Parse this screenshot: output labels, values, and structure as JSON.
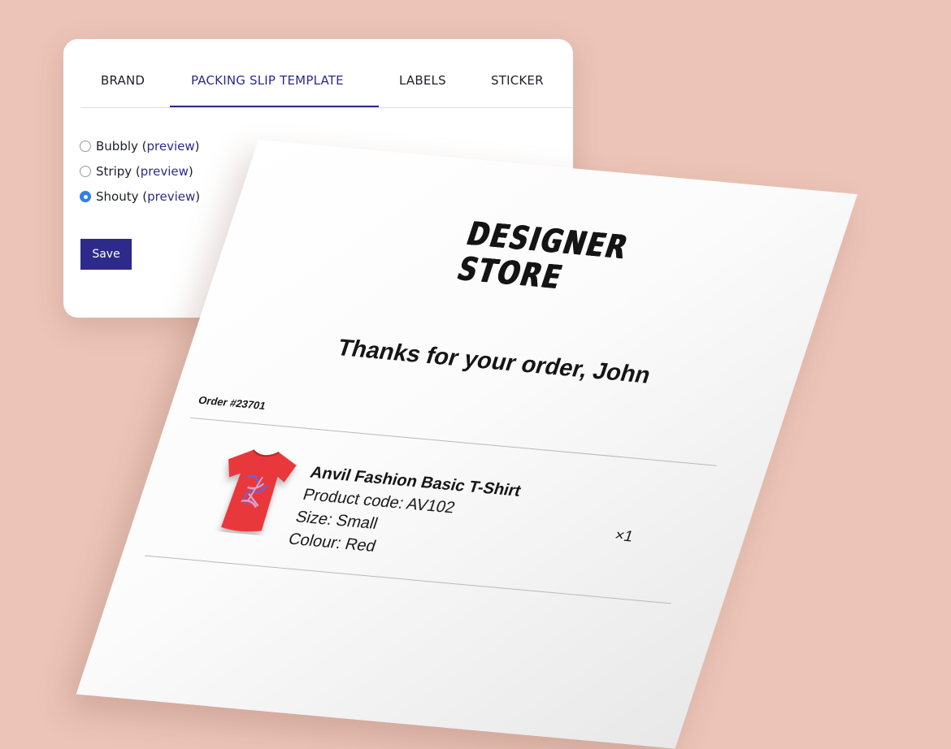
{
  "settings": {
    "tabs": [
      {
        "label": "BRAND",
        "active": false
      },
      {
        "label": "PACKING SLIP TEMPLATE",
        "active": true
      },
      {
        "label": "LABELS",
        "active": false
      },
      {
        "label": "STICKER",
        "active": false
      }
    ],
    "template_options": [
      {
        "name": "Bubbly",
        "link": "preview",
        "selected": false
      },
      {
        "name": "Stripy",
        "link": "preview",
        "selected": false
      },
      {
        "name": "Shouty",
        "link": "preview",
        "selected": true
      }
    ],
    "open_paren": "(",
    "close_paren": ")",
    "save_label": "Save"
  },
  "packing_slip": {
    "logo": {
      "line1": "DESIGNER",
      "line2": "STORE"
    },
    "title": "Thanks for your order, John",
    "order_number": "Order #23701",
    "item": {
      "image_icon": "red-tshirt-icon",
      "name": "Anvil Fashion Basic T-Shirt",
      "product_code": "Product code: AV102",
      "size": "Size: Small",
      "colour": "Colour: Red",
      "quantity": "×1"
    }
  },
  "colors": {
    "background": "#ecc5b8",
    "accent": "#2d2a8c",
    "radio_selected": "#2f80ed",
    "tshirt": "#e8383a"
  }
}
